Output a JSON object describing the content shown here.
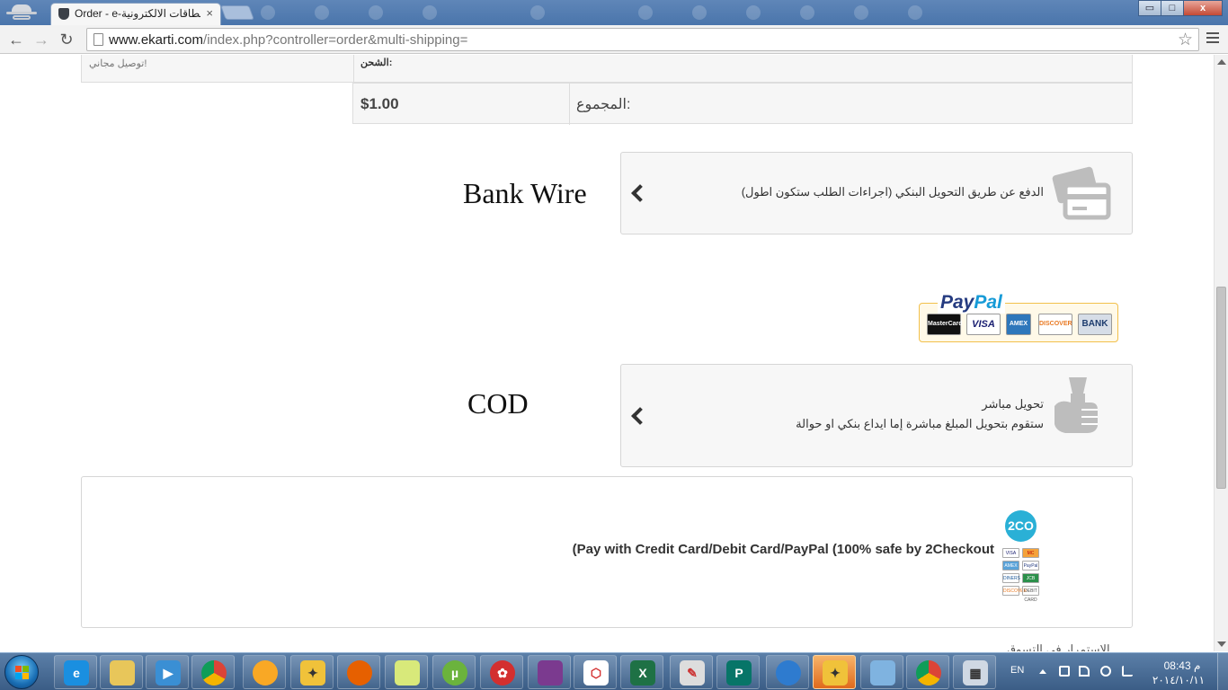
{
  "browser": {
    "tab_title": "Order - e-بطاقات الالكترونية",
    "tab_close": "×",
    "url_host": "www.ekarti.com",
    "url_path": "/index.php?controller=order&multi-shipping=",
    "window_buttons": {
      "minimize": "▭",
      "maximize": "□",
      "close": "x"
    },
    "nav": {
      "back": "←",
      "forward": "→",
      "reload": "↻",
      "bookmark": "☆"
    }
  },
  "order_summary": {
    "shipping_value": "توصيل مجاني!",
    "shipping_label": "الشحن:",
    "total_label": "المجموع:",
    "total_value": "$1.00"
  },
  "payment_methods": [
    {
      "title": "Bank Wire",
      "description": "الدفع عن طريق التحويل البنكي (اجراءات الطلب ستكون اطول)",
      "icon": "credit-card-icon"
    },
    {
      "title": "COD",
      "description_line1": "تحويل مباشر",
      "description_line2": "ستقوم بتحويل المبلغ مباشرة إما ايداع بنكي او حوالة",
      "icon": "hand-cash-icon"
    }
  ],
  "paypal_banner": {
    "logo_pay": "Pay",
    "logo_pal": "Pal",
    "cards": [
      "MasterCard",
      "VISA",
      "AMEX",
      "DISCOVER",
      "BANK"
    ]
  },
  "checkout": {
    "text": "(Pay with Credit Card/Debit Card/PayPal (100% safe by 2Checkout",
    "badge": "2CO",
    "mini_cards": [
      "VISA",
      "MC",
      "AMEX",
      "PayPal",
      "DINERS",
      "JCB",
      "DISCOVER",
      "DEBIT CARD"
    ]
  },
  "below_fold_text": "الاستمرار في التسوق",
  "taskbar": {
    "apps": [
      "internet-explorer",
      "file-explorer",
      "media-player",
      "chrome",
      "messenger",
      "games",
      "firefox",
      "sticky-notes",
      "utorrent",
      "app-red",
      "winrar",
      "pdf-reader",
      "excel",
      "paint",
      "publisher",
      "network-app",
      "yahoo-games",
      "photo-viewer",
      "chrome-2",
      "calculator"
    ],
    "language": "EN",
    "time": "08:43 م",
    "date": "٢٠١٤/١٠/١١"
  },
  "colors": {
    "tabstrip": "#4a75ab",
    "paypal_blue": "#253b80",
    "paypal_light": "#179bd7",
    "twoco_blue": "#2ab0d6",
    "active_task": "#e06a1c"
  }
}
